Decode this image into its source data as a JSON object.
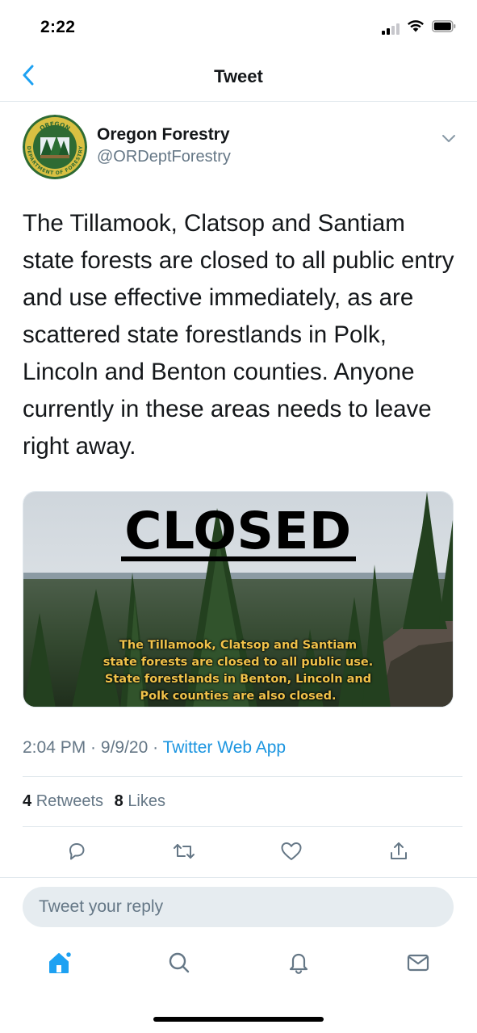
{
  "status_bar": {
    "time": "2:22"
  },
  "nav": {
    "title": "Tweet",
    "back_icon": "chevron-left-icon"
  },
  "tweet": {
    "author_name": "Oregon Forestry",
    "author_handle": "@ORDeptForestry",
    "avatar_text_top": "OREGON",
    "avatar_text_bottom": "DEPARTMENT OF FORESTRY",
    "text": "The Tillamook, Clatsop and Santiam state forests are closed to all public entry and use effective immediately, as are scattered state forestlands in Polk, Lincoln and Benton counties. Anyone currently in these areas needs to leave right away.",
    "media": {
      "headline": "CLOSED",
      "caption_lines": [
        "The Tillamook, Clatsop and Santiam",
        "state forests are closed to all public use.",
        "State forestlands in Benton, Lincoln and",
        "Polk counties are also closed."
      ]
    },
    "time": "2:04 PM",
    "date": "9/9/20",
    "source": "Twitter Web App",
    "retweets_count": "4",
    "retweets_label": "Retweets",
    "likes_count": "8",
    "likes_label": "Likes"
  },
  "reply": {
    "placeholder": "Tweet your reply"
  },
  "colors": {
    "accent": "#1da1f2",
    "muted": "#657786",
    "divider": "#e1e8ed",
    "caption": "#f0c24a"
  }
}
